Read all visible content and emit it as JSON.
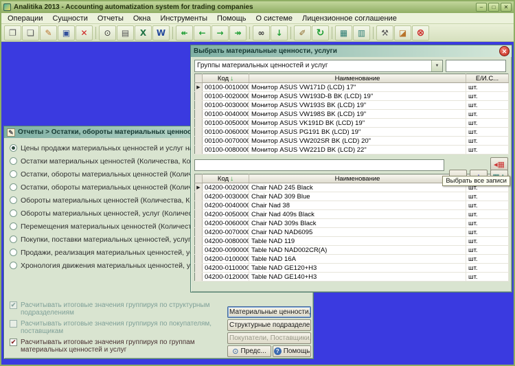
{
  "app": {
    "title": "Analitika 2013 - Accounting automatization system for trading companies",
    "window_controls": [
      {
        "name": "minimize",
        "glyph": "–"
      },
      {
        "name": "maximize",
        "glyph": "□"
      },
      {
        "name": "close",
        "glyph": "✕"
      }
    ]
  },
  "menu": {
    "items": [
      "Операции",
      "Сущности",
      "Отчеты",
      "Окна",
      "Инструменты",
      "Помощь",
      "О системе",
      "Лицензионное соглашение"
    ]
  },
  "toolbar": {
    "buttons": [
      {
        "name": "copy",
        "glyph": "❐",
        "color": "#555555"
      },
      {
        "name": "new-document",
        "glyph": "❏",
        "color": "#555555"
      },
      {
        "name": "edit-document",
        "glyph": "✎",
        "color": "#B8742C"
      },
      {
        "name": "save",
        "glyph": "▣",
        "color": "#33519C"
      },
      {
        "name": "delete",
        "glyph": "✕",
        "color": "#CC2222",
        "bold": true
      },
      {
        "separator": true
      },
      {
        "name": "print-preview",
        "glyph": "⊙",
        "color": "#333333"
      },
      {
        "name": "print",
        "glyph": "▤",
        "color": "#555555"
      },
      {
        "name": "export-excel",
        "glyph": "X",
        "color": "#217346",
        "bold": true
      },
      {
        "name": "export-word",
        "glyph": "W",
        "color": "#24499C",
        "bold": true
      },
      {
        "separator": true
      },
      {
        "name": "nav-first",
        "glyph": "↞",
        "color": "#1F9E33",
        "bold": true
      },
      {
        "name": "nav-back",
        "glyph": "←",
        "color": "#1F9E33",
        "bold": true
      },
      {
        "name": "nav-forward",
        "glyph": "→",
        "color": "#1F9E33",
        "bold": true
      },
      {
        "name": "nav-last",
        "glyph": "↠",
        "color": "#1F9E33",
        "bold": true
      },
      {
        "separator": true
      },
      {
        "name": "search-binoculars",
        "glyph": "∞",
        "color": "#333333",
        "bold": true
      },
      {
        "name": "download",
        "glyph": "↓",
        "color": "#1F9E33",
        "bold": true
      },
      {
        "separator": true
      },
      {
        "name": "design-pencil",
        "glyph": "✐",
        "color": "#8B6A2B"
      },
      {
        "name": "refresh",
        "glyph": "↻",
        "color": "#1F9E33",
        "big": true
      },
      {
        "separator": true
      },
      {
        "name": "grid-view",
        "glyph": "▦",
        "color": "#2E7D74"
      },
      {
        "name": "list-view",
        "glyph": "▥",
        "color": "#2E7D74"
      },
      {
        "separator": true
      },
      {
        "name": "tools",
        "glyph": "⚒",
        "color": "#555555"
      },
      {
        "name": "eraser",
        "glyph": "◪",
        "color": "#B8742C"
      },
      {
        "name": "stop",
        "glyph": "⊗",
        "color": "#CC2222",
        "big": true
      }
    ]
  },
  "report_window": {
    "title": "Отчеты > Остатки, обороты материальных ценностей, услуг",
    "options": [
      {
        "label": "Цены продажи материальных ценностей и услуг на текущую дату",
        "selected": true
      },
      {
        "label": "Остатки материальных ценностей (Количества, Количества * Сто",
        "selected": false
      },
      {
        "label": "Остатки, обороты материальных ценностей (Количества, Коли",
        "selected": false
      },
      {
        "label": "Остатки, обороты материальных ценностей (Количества, Коли",
        "selected": false
      },
      {
        "label": "Обороты материальных ценностей (Количества, Количества * Сто",
        "selected": false
      },
      {
        "label": "Обороты материальных ценностей, услуг (Количества, Количеств",
        "selected": false
      },
      {
        "label": "Перемещения материальных ценностей (Количества, Количества",
        "selected": false
      },
      {
        "label": "Покупки, поставки материальных ценностей, услуг",
        "selected": false
      },
      {
        "label": "Продажи, реализация материальных ценностей, услуг",
        "selected": false
      },
      {
        "label": "Хронология движения материальных ценностей, услуг",
        "selected": false
      }
    ],
    "checkboxes": [
      {
        "label": "Расчитывать итоговые значения группируя по структурным подразделениям",
        "checked": true,
        "disabled": true
      },
      {
        "label": "Расчитывать итоговые значения группируя по покупателям, поставщикам",
        "checked": false,
        "disabled": true
      },
      {
        "label": "Расчитывать итоговые значения группируя по группам материальных ценностей и услуг",
        "checked": true,
        "disabled": false
      }
    ],
    "buttons": [
      {
        "label": "Материальные ценности,У...",
        "state": "focused"
      },
      {
        "label": "Структурные подразделения",
        "state": "normal"
      },
      {
        "label": "Покупатели, Поставщики,...",
        "state": "disabled"
      },
      {
        "label": "Предс...",
        "state": "normal",
        "icon": "preview"
      },
      {
        "label": "Помощь",
        "state": "normal",
        "icon": "help"
      }
    ]
  },
  "dialog": {
    "title": "Выбрать материальные ценности, услуги",
    "group_select": {
      "value": "Группы материальных ценностей и услуг"
    },
    "filter_top": "",
    "filter_mid": "",
    "tooltip": "Выбрать все записи",
    "table_top": {
      "columns": [
        "Код",
        "Наименование",
        "Е/И.С..."
      ],
      "selected_row": 0,
      "rows": [
        [
          "00100-0010000",
          "Монитор ASUS VW171D (LCD) 17\"",
          "шт."
        ],
        [
          "00100-0020000",
          "Монитор ASUS VW193D-B BK (LCD) 19\"",
          "шт."
        ],
        [
          "00100-0030000",
          "Монитор ASUS VW193S BK (LCD) 19\"",
          "шт."
        ],
        [
          "00100-0040000",
          "Монитор ASUS VW198S BK (LCD) 19\"",
          "шт."
        ],
        [
          "00100-0050000",
          "Монитор ASUS VK191D BK (LCD) 19\"",
          "шт."
        ],
        [
          "00100-0060000",
          "Монитор ASUS PG191 BK (LCD) 19\"",
          "шт."
        ],
        [
          "00100-0070000",
          "Монитор ASUS VW202SR BK (LCD) 20\"",
          "шт."
        ],
        [
          "00100-0080000",
          "Монитор ASUS VW221D BK (LCD) 22\"",
          "шт."
        ]
      ]
    },
    "table_bottom": {
      "columns": [
        "Код",
        "Наименование",
        ""
      ],
      "selected_row": 0,
      "rows": [
        [
          "04200-0020000",
          "Chair NAD 245 Black",
          "шт."
        ],
        [
          "04200-0030000",
          "Chair NAD 309 Blue",
          "шт."
        ],
        [
          "04200-0040000",
          "Chair Nad 38",
          "шт."
        ],
        [
          "04200-0050000",
          "Chair Nad 409s Black",
          "шт."
        ],
        [
          "04200-0060000",
          "Chair NAD 309s Black",
          "шт."
        ],
        [
          "04200-0070000",
          "Chair NAD NAD6095",
          "шт."
        ],
        [
          "04200-0080000",
          "Table NAD 119",
          "шт."
        ],
        [
          "04200-0090000",
          "Table NAD NAD002CR(A)",
          "шт."
        ],
        [
          "04200-0100000",
          "Table NAD 16A",
          "шт."
        ],
        [
          "04200-0110000",
          "Table NAD GE120+H3",
          "шт."
        ],
        [
          "04200-0120000",
          "Table NAD GE140+H3",
          "шт."
        ]
      ]
    }
  },
  "icons": {
    "sort_arrow": "↓",
    "row_marker": "▶",
    "dropdown_arrow": "▼",
    "close": "✕",
    "check": "✔",
    "report": "✎",
    "preview": "⊙",
    "help": "?",
    "select_all": "◂▦",
    "remove": "−",
    "add": "+",
    "add_all": "▦+"
  },
  "colors": {
    "desktop": "#3A3AE0",
    "titlebar_green": "#8FAE64",
    "window_title_teal": "#7FB0A4",
    "sort_arrow_green": "#1F9E33",
    "close_red": "#C62B1E"
  }
}
